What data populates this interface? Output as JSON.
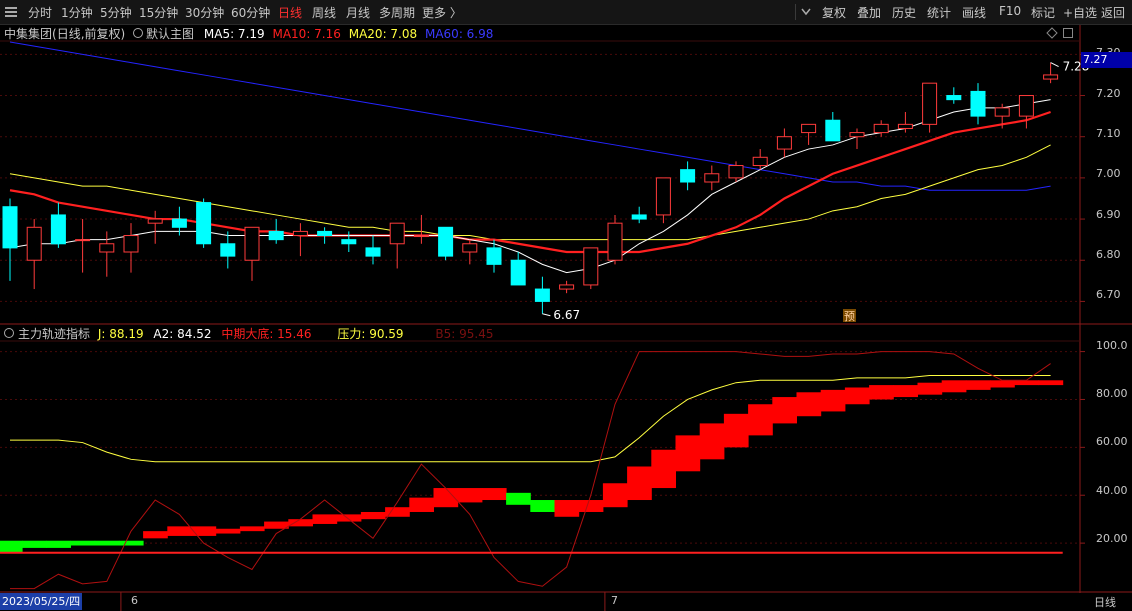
{
  "toolbar": {
    "periods": [
      "分时",
      "1分钟",
      "5分钟",
      "15分钟",
      "30分钟",
      "60分钟",
      "日线",
      "周线",
      "月线",
      "多周期",
      "更多 〉"
    ],
    "active_period": "日线",
    "tools": [
      "复权",
      "叠加",
      "历史",
      "统计",
      "画线",
      "F10",
      "标记",
      "+自选",
      "返回"
    ]
  },
  "main_panel": {
    "stock_name": "中集集团",
    "mode": "(日线,前复权)",
    "indicator_name": "默认主图",
    "ma5": "MA5: 7.19",
    "ma10": "MA10: 7.16",
    "ma20": "MA20: 7.08",
    "ma60": "MA60: 6.98",
    "y_ticks": [
      "7.30",
      "7.20",
      "7.10",
      "7.00",
      "6.90",
      "6.80",
      "6.70"
    ],
    "current_price": "7.27",
    "high_label": "7.28",
    "low_label": "6.67",
    "pred_marker": "预"
  },
  "sub_panel": {
    "indicator_name": "主力轨迹指标",
    "j": "J: 88.19",
    "a2": "A2: 84.52",
    "bottom": "中期大底: 15.46",
    "pressure": "压力: 90.59",
    "b5": "B5: 95.45",
    "y_ticks": [
      "100.0",
      "80.00",
      "60.00",
      "40.00",
      "20.00"
    ]
  },
  "x_axis": {
    "date_cursor": "2023/05/25/四",
    "month_labels": [
      "6",
      "7"
    ],
    "period_tag": "日线"
  },
  "colors": {
    "up": "#ff3b3b",
    "down": "#00ffff",
    "ma5": "#ffffff",
    "ma10": "#ff2020",
    "ma20": "#ffff40",
    "ma60": "#2424ff",
    "accent": "#ff3030",
    "background": "#000000"
  },
  "chart_data": [
    {
      "type": "candlestick",
      "title": "中集集团 (日线,前复权)",
      "ylim": [
        6.65,
        7.33
      ],
      "candles": [
        [
          6.93,
          6.95,
          6.75,
          6.83
        ],
        [
          6.8,
          6.9,
          6.73,
          6.88
        ],
        [
          6.91,
          6.94,
          6.83,
          6.84
        ],
        [
          6.85,
          6.9,
          6.77,
          6.85
        ],
        [
          6.82,
          6.87,
          6.76,
          6.84
        ],
        [
          6.82,
          6.89,
          6.77,
          6.86
        ],
        [
          6.89,
          6.92,
          6.84,
          6.9
        ],
        [
          6.9,
          6.93,
          6.86,
          6.88
        ],
        [
          6.94,
          6.95,
          6.83,
          6.84
        ],
        [
          6.84,
          6.87,
          6.78,
          6.81
        ],
        [
          6.8,
          6.88,
          6.75,
          6.88
        ],
        [
          6.87,
          6.9,
          6.84,
          6.85
        ],
        [
          6.86,
          6.89,
          6.81,
          6.87
        ],
        [
          6.87,
          6.88,
          6.84,
          6.86
        ],
        [
          6.85,
          6.87,
          6.82,
          6.84
        ],
        [
          6.83,
          6.86,
          6.79,
          6.81
        ],
        [
          6.84,
          6.89,
          6.78,
          6.89
        ],
        [
          6.86,
          6.91,
          6.84,
          6.86
        ],
        [
          6.88,
          6.88,
          6.8,
          6.81
        ],
        [
          6.82,
          6.85,
          6.79,
          6.84
        ],
        [
          6.83,
          6.85,
          6.77,
          6.79
        ],
        [
          6.8,
          6.82,
          6.76,
          6.74
        ],
        [
          6.73,
          6.76,
          6.67,
          6.7
        ],
        [
          6.73,
          6.75,
          6.72,
          6.74
        ],
        [
          6.74,
          6.82,
          6.73,
          6.83
        ],
        [
          6.8,
          6.91,
          6.79,
          6.89
        ],
        [
          6.91,
          6.93,
          6.89,
          6.9
        ],
        [
          6.91,
          7.0,
          6.89,
          7.0
        ],
        [
          7.02,
          7.04,
          6.97,
          6.99
        ],
        [
          6.99,
          7.03,
          6.97,
          7.01
        ],
        [
          7.0,
          7.04,
          6.99,
          7.03
        ],
        [
          7.03,
          7.07,
          7.02,
          7.05
        ],
        [
          7.07,
          7.12,
          7.05,
          7.1
        ],
        [
          7.11,
          7.13,
          7.08,
          7.13
        ],
        [
          7.14,
          7.16,
          7.09,
          7.09
        ],
        [
          7.1,
          7.12,
          7.07,
          7.11
        ],
        [
          7.11,
          7.14,
          7.1,
          7.13
        ],
        [
          7.12,
          7.16,
          7.11,
          7.13
        ],
        [
          7.13,
          7.23,
          7.11,
          7.23
        ],
        [
          7.2,
          7.22,
          7.18,
          7.19
        ],
        [
          7.21,
          7.23,
          7.13,
          7.15
        ],
        [
          7.15,
          7.18,
          7.12,
          7.17
        ],
        [
          7.15,
          7.2,
          7.12,
          7.2
        ],
        [
          7.24,
          7.28,
          7.23,
          7.25
        ]
      ],
      "ma5": [
        6.83,
        6.84,
        6.84,
        6.85,
        6.85,
        6.86,
        6.87,
        6.87,
        6.87,
        6.86,
        6.86,
        6.86,
        6.86,
        6.86,
        6.86,
        6.86,
        6.86,
        6.86,
        6.86,
        6.85,
        6.84,
        6.82,
        6.79,
        6.77,
        6.78,
        6.8,
        6.84,
        6.87,
        6.91,
        6.96,
        6.99,
        7.02,
        7.05,
        7.07,
        7.08,
        7.1,
        7.11,
        7.12,
        7.14,
        7.16,
        7.17,
        7.17,
        7.18,
        7.19
      ],
      "ma10": [
        6.97,
        6.96,
        6.94,
        6.93,
        6.92,
        6.91,
        6.9,
        6.9,
        6.89,
        6.88,
        6.87,
        6.87,
        6.86,
        6.86,
        6.86,
        6.86,
        6.86,
        6.86,
        6.86,
        6.85,
        6.85,
        6.84,
        6.83,
        6.82,
        6.82,
        6.82,
        6.82,
        6.83,
        6.84,
        6.86,
        6.88,
        6.91,
        6.95,
        6.98,
        7.01,
        7.03,
        7.05,
        7.07,
        7.09,
        7.11,
        7.12,
        7.13,
        7.14,
        7.16
      ],
      "ma20": [
        7.01,
        7.0,
        6.99,
        6.98,
        6.98,
        6.97,
        6.96,
        6.95,
        6.94,
        6.93,
        6.92,
        6.91,
        6.9,
        6.89,
        6.88,
        6.88,
        6.87,
        6.87,
        6.86,
        6.86,
        6.85,
        6.85,
        6.85,
        6.85,
        6.85,
        6.85,
        6.85,
        6.85,
        6.85,
        6.86,
        6.87,
        6.88,
        6.89,
        6.9,
        6.92,
        6.93,
        6.95,
        6.96,
        6.98,
        7.0,
        7.02,
        7.03,
        7.05,
        7.08
      ],
      "ma60": [
        7.33,
        7.32,
        7.31,
        7.3,
        7.29,
        7.28,
        7.27,
        7.26,
        7.25,
        7.24,
        7.23,
        7.22,
        7.21,
        7.2,
        7.19,
        7.18,
        7.17,
        7.16,
        7.15,
        7.14,
        7.13,
        7.12,
        7.11,
        7.1,
        7.09,
        7.08,
        7.07,
        7.06,
        7.05,
        7.04,
        7.03,
        7.02,
        7.01,
        7.0,
        6.99,
        6.99,
        6.98,
        6.98,
        6.97,
        6.97,
        6.97,
        6.97,
        6.97,
        6.98
      ]
    },
    {
      "type": "area",
      "title": "主力轨迹指标",
      "ylim": [
        0,
        104
      ],
      "ribbon_top": [
        21,
        21,
        21,
        21,
        21,
        21,
        25,
        27,
        27,
        26,
        27,
        29,
        30,
        32,
        32,
        33,
        35,
        39,
        43,
        43,
        43,
        41,
        38,
        38,
        38,
        45,
        52,
        59,
        65,
        70,
        74,
        78,
        81,
        83,
        84,
        85,
        86,
        86,
        87,
        88,
        88,
        88,
        88,
        88
      ],
      "ribbon_bottom": [
        16,
        18,
        18,
        19,
        19,
        19,
        22,
        23,
        23,
        24,
        25,
        26,
        27,
        28,
        29,
        30,
        31,
        33,
        35,
        37,
        38,
        36,
        33,
        31,
        33,
        35,
        38,
        43,
        50,
        55,
        60,
        65,
        70,
        73,
        75,
        78,
        80,
        81,
        82,
        83,
        84,
        85,
        86,
        86
      ],
      "j_line": [
        1,
        1,
        7,
        3,
        4,
        25,
        38,
        32,
        20,
        14,
        9,
        24,
        30,
        38,
        30,
        22,
        37,
        53,
        43,
        32,
        14,
        4,
        2,
        10,
        40,
        78,
        100,
        100,
        100,
        100,
        100,
        99,
        98,
        98,
        99,
        99,
        100,
        100,
        100,
        99,
        93,
        88,
        88,
        95
      ],
      "pressure_line": [
        63,
        63,
        63,
        62,
        58,
        55,
        54,
        54,
        54,
        54,
        54,
        54,
        54,
        54,
        54,
        54,
        54,
        54,
        54,
        54,
        54,
        54,
        54,
        54,
        54,
        56,
        64,
        73,
        80,
        84,
        87,
        88,
        88,
        88,
        88,
        89,
        89,
        89,
        90,
        90,
        90,
        90,
        90,
        90
      ],
      "bottom_line": [
        16,
        16,
        16,
        16,
        16,
        16,
        16,
        16,
        16,
        16,
        16,
        16,
        16,
        16,
        16,
        16,
        16,
        16,
        16,
        16,
        16,
        16,
        16,
        16,
        16,
        16,
        16,
        16,
        16,
        16,
        16,
        16,
        16,
        16,
        16,
        16,
        16,
        16,
        16,
        16,
        16,
        16,
        16,
        16
      ]
    }
  ]
}
